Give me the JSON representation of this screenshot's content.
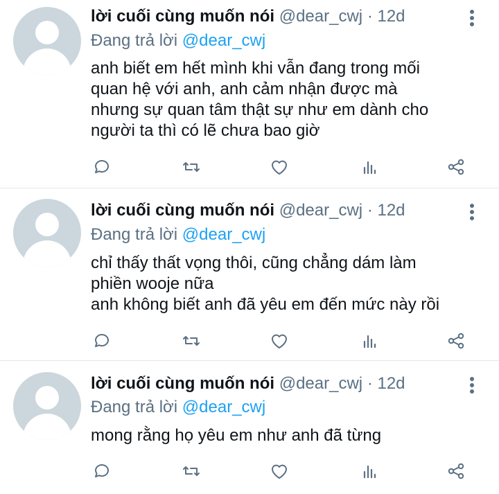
{
  "colors": {
    "text": "#0f1419",
    "secondary": "#5b7083",
    "link": "#1da1f2",
    "divider": "#e3e6e8",
    "avatar_bg": "#ccd6dd"
  },
  "tweets": [
    {
      "author": "lời cuối cùng muốn nói",
      "handle": "@dear_cwj",
      "dot": "·",
      "time": "12d",
      "reply_prefix": "Đang trả lời",
      "reply_mention": "@dear_cwj",
      "lines": [
        "anh biết em hết mình khi vẫn đang trong mối",
        "quan hệ với anh, anh cảm nhận được mà",
        "nhưng sự quan tâm thật sự như em dành cho",
        "người ta thì có lẽ chưa bao giờ"
      ]
    },
    {
      "author": "lời cuối cùng muốn nói",
      "handle": "@dear_cwj",
      "dot": "·",
      "time": "12d",
      "reply_prefix": "Đang trả lời",
      "reply_mention": "@dear_cwj",
      "lines": [
        "chỉ thấy thất vọng thôi, cũng chẳng dám làm",
        "phiền wooje nữa",
        "anh không biết anh đã yêu em đến mức này rồi"
      ]
    },
    {
      "author": "lời cuối cùng muốn nói",
      "handle": "@dear_cwj",
      "dot": "·",
      "time": "12d",
      "reply_prefix": "Đang trả lời",
      "reply_mention": "@dear_cwj",
      "lines": [
        "mong rằng họ yêu em như anh đã từng"
      ]
    }
  ],
  "action_icons": [
    "reply-icon",
    "retweet-icon",
    "like-icon",
    "analytics-icon",
    "share-icon"
  ]
}
